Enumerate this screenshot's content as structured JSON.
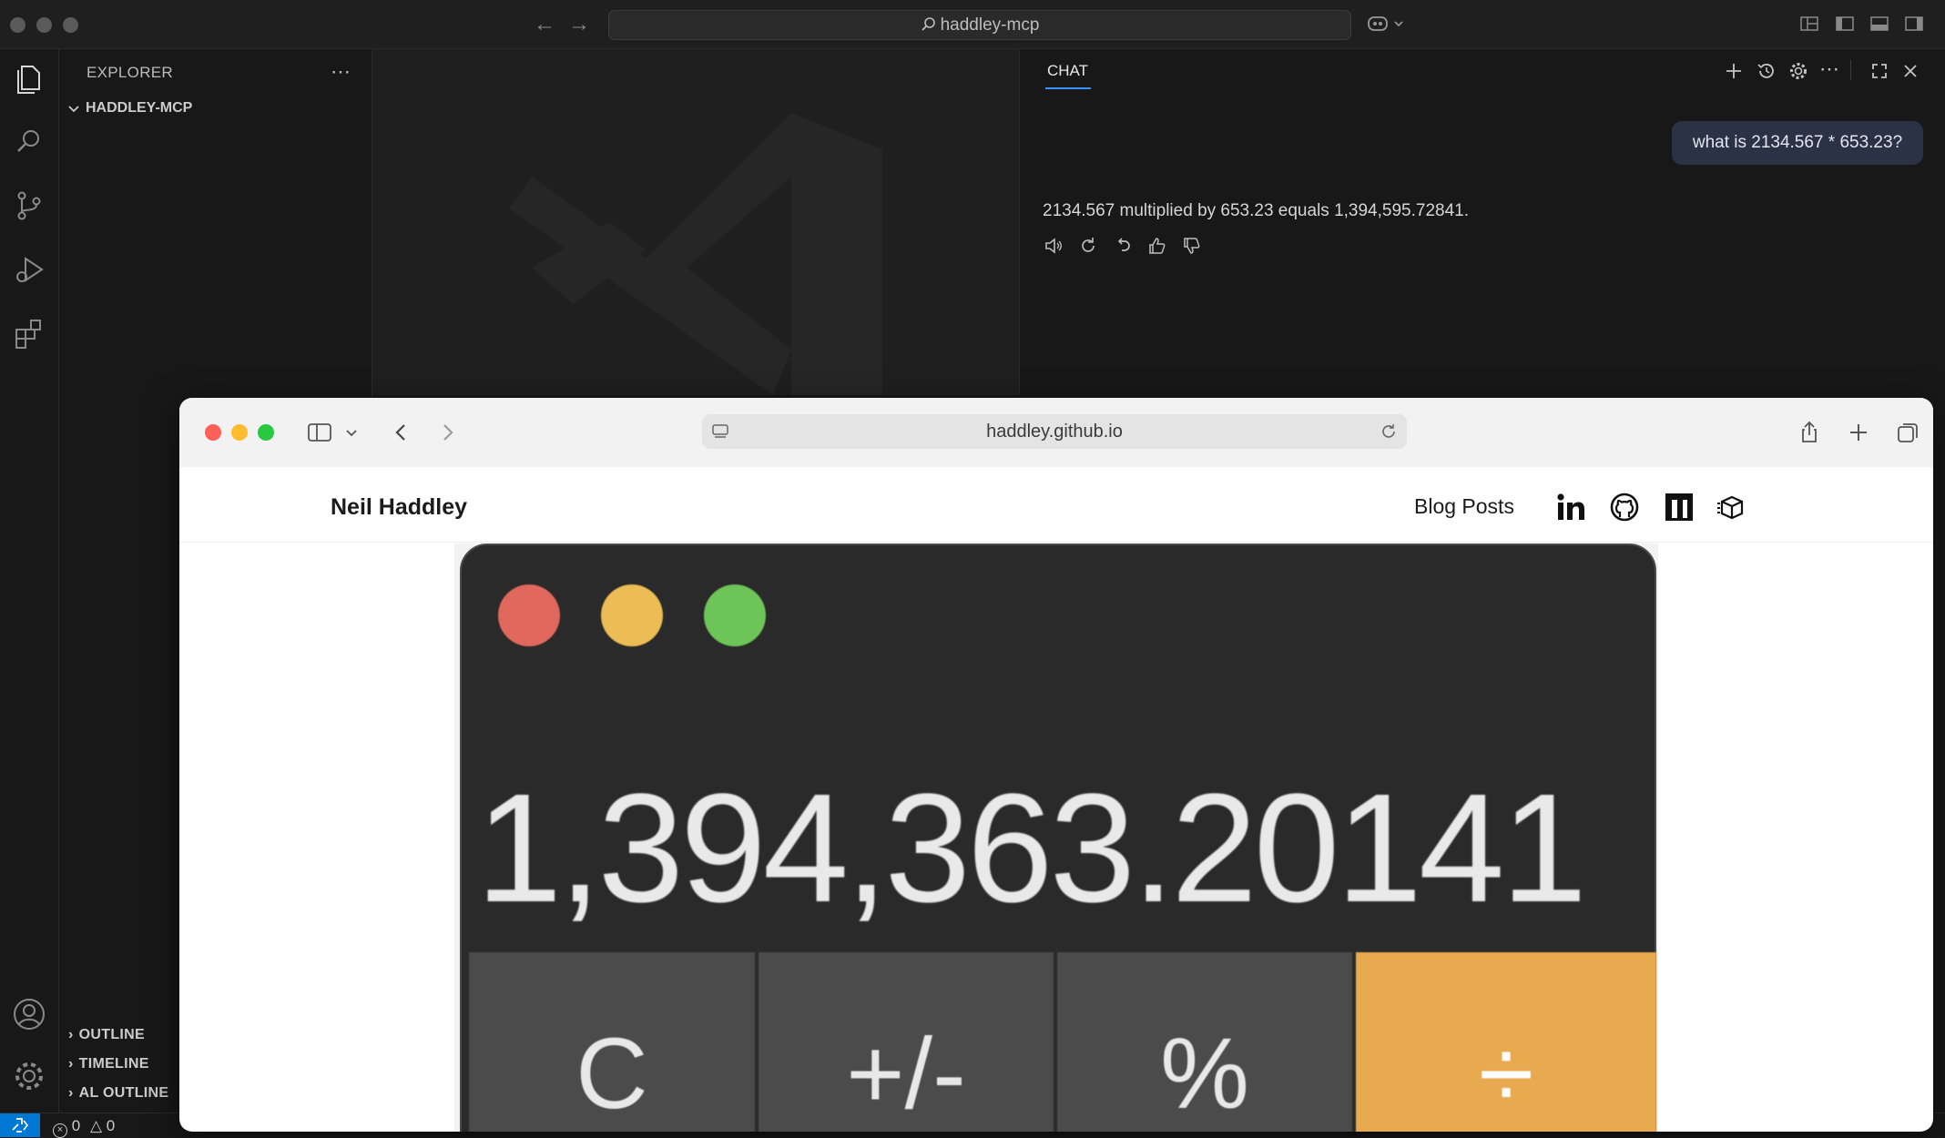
{
  "titlebar": {
    "search_text": "haddley-mcp"
  },
  "sidebar": {
    "title": "EXPLORER",
    "root_folder": "HADDLEY-MCP",
    "sections": [
      "OUTLINE",
      "TIMELINE",
      "AL OUTLINE"
    ]
  },
  "chat": {
    "tab_label": "CHAT",
    "user_message": "what is 2134.567 * 653.23?",
    "assistant_message": "2134.567 multiplied by 653.23 equals 1,394,595.72841."
  },
  "statusbar": {
    "errors": "0",
    "warnings": "0"
  },
  "browser": {
    "url": "haddley.github.io",
    "site_name": "Neil Haddley",
    "nav_link": "Blog Posts",
    "social_icons": [
      "linkedin-icon",
      "github-icon",
      "medium-icon",
      "box-icon"
    ]
  },
  "calculator": {
    "display": "1,394,363.20141",
    "keys": [
      "C",
      "+/-",
      "%",
      "÷"
    ]
  },
  "colors": {
    "accent": "#0078d4",
    "tab_underline": "#3794ff",
    "calc_operator": "#e9a94e",
    "traffic_red": "#fe5f57",
    "traffic_yellow": "#febc2e",
    "traffic_green": "#28c840"
  }
}
